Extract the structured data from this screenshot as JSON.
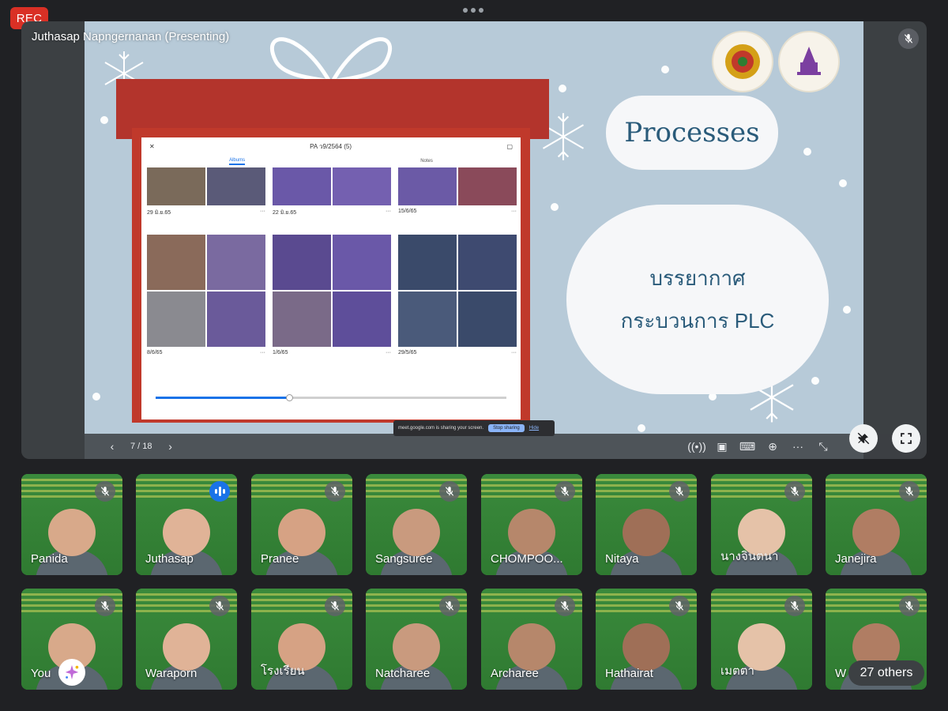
{
  "recording": {
    "label": "REC"
  },
  "presentation": {
    "presenter_label": "Juthasap Napngernanan (Presenting)",
    "slide": {
      "title": "Processes",
      "body_line1": "บรรยากาศ",
      "body_line2": "กระบวนการ PLC",
      "album": {
        "header": "PA ว9/2564 (5)",
        "tab_albums": "Albums",
        "tab_notes": "Notes",
        "captions": [
          "29 มิ.ย.65",
          "22 มิ.ย.65",
          "15/6/65",
          "8/6/65",
          "1/6/65",
          "29/5/65"
        ]
      }
    },
    "share_banner": {
      "text": "meet.google.com is sharing your screen.",
      "stop_label": "Stop sharing",
      "hide_label": "Hide"
    },
    "pager": {
      "text": "7 / 18"
    }
  },
  "participants": [
    {
      "name": "Panida",
      "speaking": false
    },
    {
      "name": "Juthasap",
      "speaking": true
    },
    {
      "name": "Pranee",
      "speaking": false
    },
    {
      "name": "Sangsuree",
      "speaking": false
    },
    {
      "name": "CHOMPOO...",
      "speaking": false
    },
    {
      "name": "Nitaya",
      "speaking": false
    },
    {
      "name": "นางจินตนา",
      "speaking": false
    },
    {
      "name": "Janejira",
      "speaking": false
    },
    {
      "name": "You",
      "speaking": false
    },
    {
      "name": "Waraporn",
      "speaking": false
    },
    {
      "name": "โรงเรียน",
      "speaking": false
    },
    {
      "name": "Natcharee",
      "speaking": false
    },
    {
      "name": "Archaree",
      "speaking": false
    },
    {
      "name": "Hathairat",
      "speaking": false
    },
    {
      "name": "เมตตา",
      "speaking": false
    },
    {
      "name": "W",
      "speaking": false
    }
  ],
  "others": {
    "label": "27 others"
  },
  "colors": {
    "rec": "#d93025",
    "accent": "#1a73e8",
    "tile_bg": "#2e7d32"
  }
}
